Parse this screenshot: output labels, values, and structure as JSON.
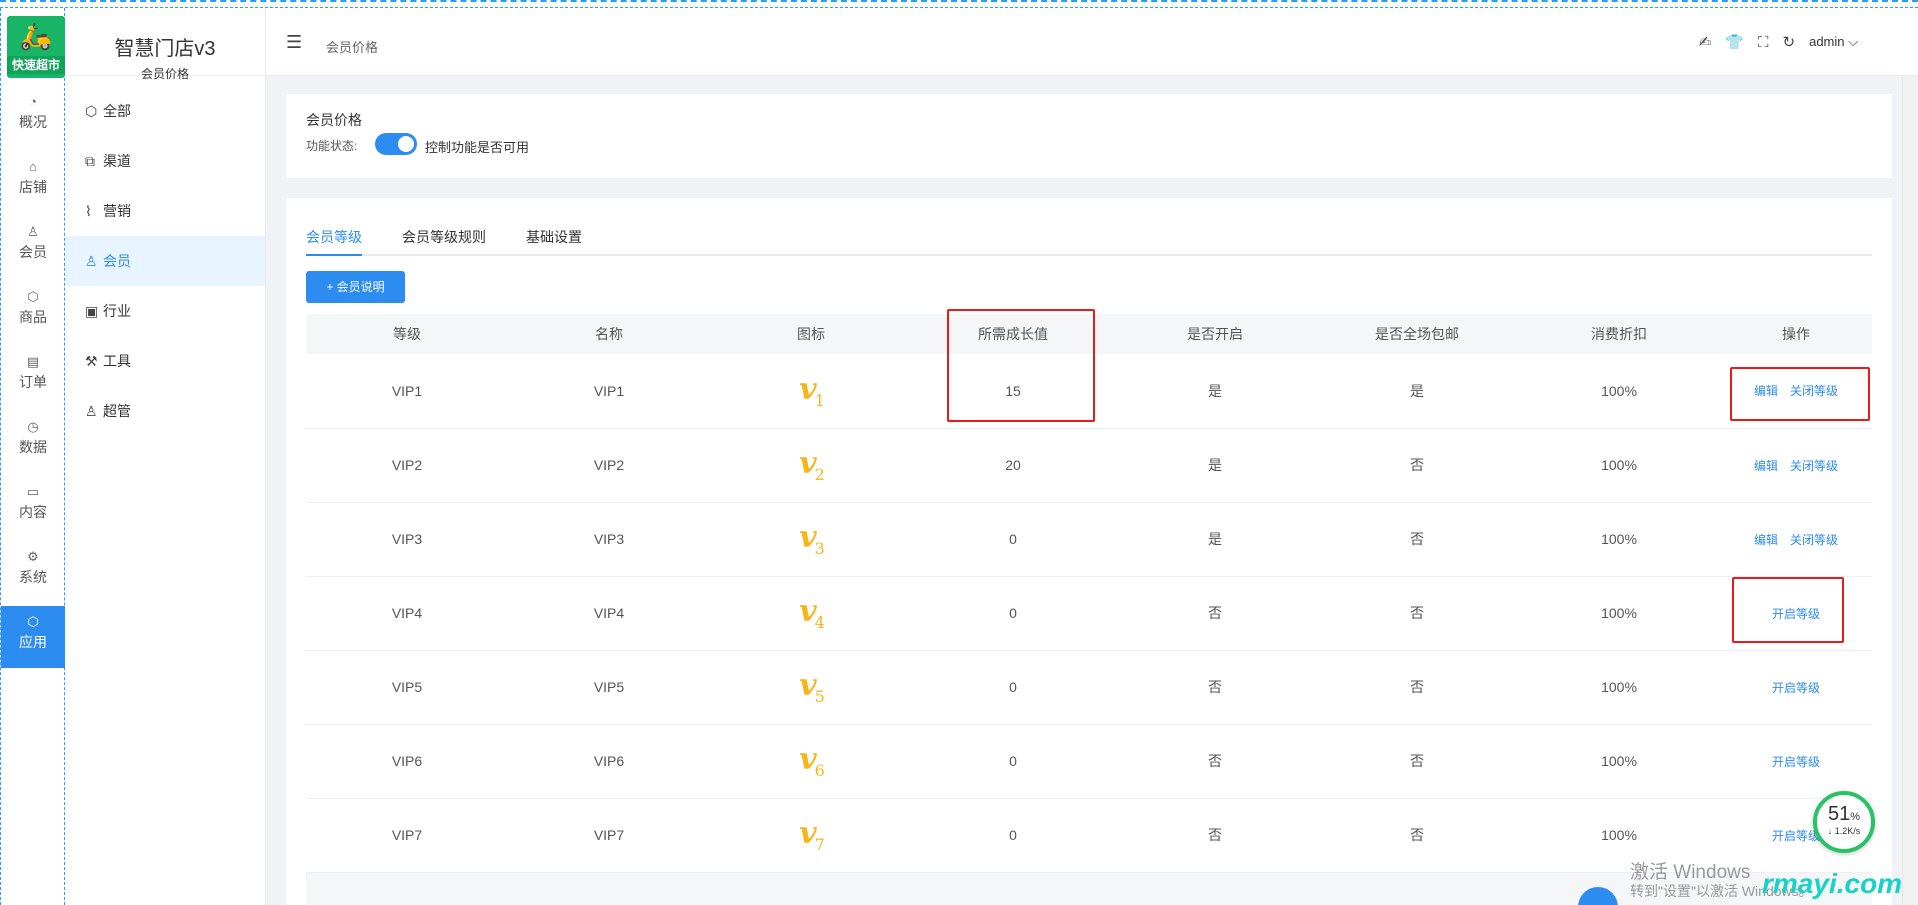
{
  "rail": {
    "logo_text": "快速超市",
    "items": [
      {
        "label": "概况",
        "icon": "dashboard-icon",
        "glyph": "◔"
      },
      {
        "label": "店铺",
        "icon": "store-icon",
        "glyph": "⌂"
      },
      {
        "label": "会员",
        "icon": "user-icon",
        "glyph": "♙"
      },
      {
        "label": "商品",
        "icon": "box-icon",
        "glyph": "⬡"
      },
      {
        "label": "订单",
        "icon": "clipboard-icon",
        "glyph": "▤"
      },
      {
        "label": "数据",
        "icon": "pie-chart-icon",
        "glyph": "◷"
      },
      {
        "label": "内容",
        "icon": "folder-icon",
        "glyph": "▭"
      },
      {
        "label": "系统",
        "icon": "gear-icon",
        "glyph": "⚙"
      },
      {
        "label": "应用",
        "icon": "app-icon",
        "glyph": "⬡"
      }
    ]
  },
  "brand": {
    "name": "智慧门店v3",
    "sub": "会员价格"
  },
  "menu": [
    {
      "label": "全部",
      "icon": "cube-icon",
      "glyph": "⬡"
    },
    {
      "label": "渠道",
      "icon": "channel-icon",
      "glyph": "⧉"
    },
    {
      "label": "营销",
      "icon": "trend-icon",
      "glyph": "⌇"
    },
    {
      "label": "会员",
      "icon": "member-icon",
      "glyph": "♙"
    },
    {
      "label": "行业",
      "icon": "briefcase-icon",
      "glyph": "▣"
    },
    {
      "label": "工具",
      "icon": "wrench-icon",
      "glyph": "⚒"
    },
    {
      "label": "超管",
      "icon": "admin-icon",
      "glyph": "♙"
    }
  ],
  "header": {
    "breadcrumb": "会员价格",
    "fold_glyph": "☰",
    "user": "admin",
    "tool_glyphs": [
      "✍",
      "👕",
      "⛶",
      "↻"
    ]
  },
  "status": {
    "title": "会员价格",
    "label": "功能状态:",
    "hint": "控制功能是否可用"
  },
  "tabs": [
    "会员等级",
    "会员等级规则",
    "基础设置"
  ],
  "add_button": "+ 会员说明",
  "table": {
    "headers": [
      "等级",
      "名称",
      "图标",
      "所需成长值",
      "是否开启",
      "是否全场包邮",
      "消费折扣",
      "操作"
    ],
    "rows": [
      {
        "level": "VIP1",
        "name": "VIP1",
        "n": "1",
        "growth": "15",
        "open": "是",
        "free_ship": "是",
        "discount": "100%",
        "actions": [
          "编辑",
          "关闭等级"
        ]
      },
      {
        "level": "VIP2",
        "name": "VIP2",
        "n": "2",
        "growth": "20",
        "open": "是",
        "free_ship": "否",
        "discount": "100%",
        "actions": [
          "编辑",
          "关闭等级"
        ]
      },
      {
        "level": "VIP3",
        "name": "VIP3",
        "n": "3",
        "growth": "0",
        "open": "是",
        "free_ship": "否",
        "discount": "100%",
        "actions": [
          "编辑",
          "关闭等级"
        ]
      },
      {
        "level": "VIP4",
        "name": "VIP4",
        "n": "4",
        "growth": "0",
        "open": "否",
        "free_ship": "否",
        "discount": "100%",
        "actions": [
          "开启等级"
        ]
      },
      {
        "level": "VIP5",
        "name": "VIP5",
        "n": "5",
        "growth": "0",
        "open": "否",
        "free_ship": "否",
        "discount": "100%",
        "actions": [
          "开启等级"
        ]
      },
      {
        "level": "VIP6",
        "name": "VIP6",
        "n": "6",
        "growth": "0",
        "open": "否",
        "free_ship": "否",
        "discount": "100%",
        "actions": [
          "开启等级"
        ]
      },
      {
        "level": "VIP7",
        "name": "VIP7",
        "n": "7",
        "growth": "0",
        "open": "否",
        "free_ship": "否",
        "discount": "100%",
        "actions": [
          "开启等级"
        ]
      }
    ],
    "badge_letter": "v"
  },
  "overlay": {
    "win_line1": "激活 Windows",
    "win_line2": "转到\"设置\"以激活 Windows。",
    "site": "rmayi.com",
    "speed_pct": "51",
    "speed_unit": "%",
    "speed_rate": "↓ 1.2K/s"
  },
  "colors": {
    "accent": "#2d8cf0",
    "highlight": "#e41c1c",
    "badge": "#f7b51c",
    "logo": "#18b566"
  }
}
